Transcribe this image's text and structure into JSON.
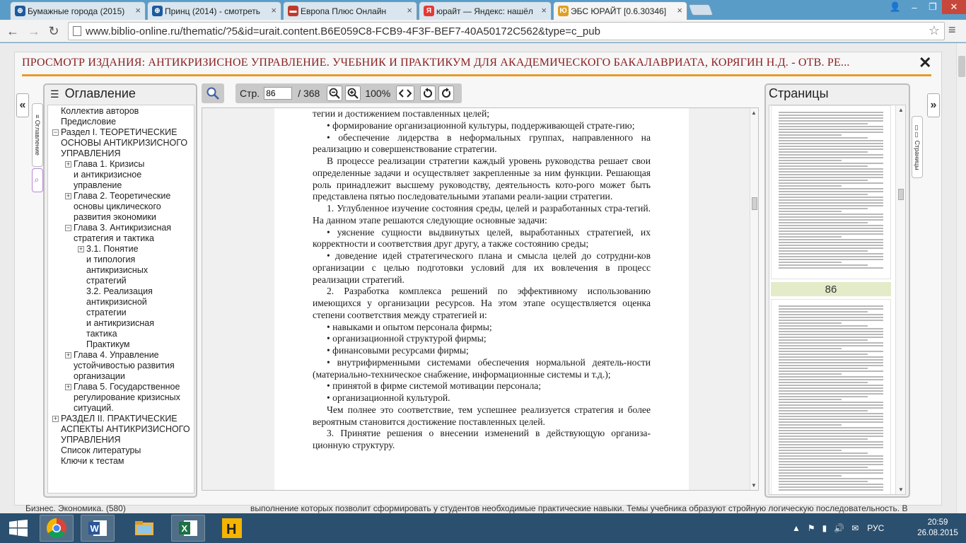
{
  "browser": {
    "tabs": [
      {
        "label": "Бумажные города (2015)",
        "icon": "film-icon",
        "color": "#1d5a9e",
        "active": false
      },
      {
        "label": "Принц (2014) - смотреть",
        "icon": "film-icon",
        "color": "#1d5a9e",
        "active": false
      },
      {
        "label": "Европа Плюс Онлайн",
        "icon": "radio-icon",
        "color": "#c0392b",
        "active": false
      },
      {
        "label": "юрайт — Яндекс: нашёл",
        "icon": "yandex-icon",
        "color": "#e53935",
        "active": false
      },
      {
        "label": "ЭБС ЮРАЙТ [0.6.30346]",
        "icon": "urait-icon",
        "color": "#e0a020",
        "active": true
      }
    ],
    "url": "www.biblio-online.ru/thematic/?5&id=urait.content.B6E059C8-FCB9-4F3F-BEF7-40A50172C562&type=c_pub",
    "back_glyph": "←",
    "forward_glyph": "→",
    "reload_glyph": "↻",
    "star_glyph": "☆",
    "menu_glyph": "≡",
    "close_glyph": "×",
    "win_controls": [
      "👤",
      "–",
      "❐",
      "✕"
    ]
  },
  "viewer": {
    "title": "ПРОСМОТР ИЗДАНИЯ: АНТИКРИЗИСНОЕ УПРАВЛЕНИЕ. УЧЕБНИК И ПРАКТИКУМ ДЛЯ АКАДЕМИЧЕСКОГО БАКАЛАВРИАТА, КОРЯГИН Н.Д. - ОТВ. РЕ...",
    "close_label": "✕",
    "left_toggle": "«",
    "right_toggle": "»",
    "left_vtab_label": "≡ Оглавление",
    "right_vtab_label": "▯▯ Страницы",
    "search_vtab_glyph": "⌕",
    "page_label": "Стр.",
    "page_value": "86",
    "page_total": "/ 368",
    "zoom": "100%",
    "accent": "#e89a2a",
    "title_color": "#8b2020"
  },
  "toc": {
    "header": "Оглавление",
    "items": [
      {
        "text": "Коллектив авторов",
        "level": 0,
        "toggle": ""
      },
      {
        "text": "Предисловие",
        "level": 0,
        "toggle": ""
      },
      {
        "text": "Раздел I. ТЕОРЕТИЧЕСКИЕ\nОСНОВЫ АНТИКРИЗИСНОГО\nУПРАВЛЕНИЯ",
        "level": 0,
        "toggle": "−"
      },
      {
        "text": "Глава 1. Кризисы\nи антикризисное\nуправление",
        "level": 1,
        "toggle": "+"
      },
      {
        "text": "Глава 2. Теоретические\nосновы циклического\nразвития экономики",
        "level": 1,
        "toggle": "+"
      },
      {
        "text": "Глава 3. Антикризисная\nстратегия и тактика",
        "level": 1,
        "toggle": "−"
      },
      {
        "text": "3.1. Понятие\nи типология\nантикризисных\nстратегий",
        "level": 2,
        "toggle": "+"
      },
      {
        "text": "3.2. Реализация\nантикризисной\nстратегии\nи антикризисная\nтактика",
        "level": 2,
        "toggle": ""
      },
      {
        "text": "Практикум",
        "level": 2,
        "toggle": ""
      },
      {
        "text": "Глава 4. Управление\nустойчивостью развития\nорганизации",
        "level": 1,
        "toggle": "+"
      },
      {
        "text": "Глава 5. Государственное\nрегулирование кризисных\nситуаций.",
        "level": 1,
        "toggle": "+"
      },
      {
        "text": "РАЗДЕЛ II. ПРАКТИЧЕСКИЕ\nАСПЕКТЫ АНТИКРИЗИСНОГО\nУПРАВЛЕНИЯ",
        "level": 0,
        "toggle": "+"
      },
      {
        "text": "Список литературы",
        "level": 0,
        "toggle": ""
      },
      {
        "text": "Ключи к тестам",
        "level": 0,
        "toggle": ""
      }
    ]
  },
  "document": {
    "paragraphs": [
      {
        "kind": "cont",
        "text": "тегии и достижением поставленных целей;"
      },
      {
        "kind": "bul",
        "text": "•  формирование организационной культуры, поддерживающей страте-гию;"
      },
      {
        "kind": "bul",
        "text": "•  обеспечение лидерства в неформальных группах, направленного на реализацию и совершенствование стратегии."
      },
      {
        "kind": "ind",
        "text": "В процессе реализации стратегии каждый уровень руководства решает свои определенные задачи и осуществляет закрепленные за ним функции. Решающая роль принадлежит высшему руководству, деятельность кото-рого может быть представлена пятью последовательными этапами реали-зации стратегии."
      },
      {
        "kind": "ind",
        "text": "1. Углубленное изучение состояния среды, целей и разработанных стра-тегий. На данном этапе решаются следующие основные задачи:"
      },
      {
        "kind": "bul",
        "text": "•  уяснение сущности выдвинутых целей, выработанных стратегией, их корректности и соответствия друг другу, а также состоянию среды;"
      },
      {
        "kind": "bul",
        "text": "•  доведение идей стратегического плана и смысла целей до сотрудни-ков организации с целью подготовки условий для их вовлечения в процесс реализации стратегий."
      },
      {
        "kind": "ind",
        "text": "2. Разработка комплекса решений по эффективному использованию имеющихся у организации ресурсов. На этом этапе осуществляется оценка степени соответствия между стратегией и:"
      },
      {
        "kind": "bul",
        "text": "•  навыками и опытом персонала фирмы;"
      },
      {
        "kind": "bul",
        "text": "•  организационной структурой фирмы;"
      },
      {
        "kind": "bul",
        "text": "•  финансовыми ресурсами фирмы;"
      },
      {
        "kind": "bul",
        "text": "•  внутрифирменными системами обеспечения нормальной деятель-ности (материально-техническое снабжение, информационные системы и т.д.);"
      },
      {
        "kind": "bul",
        "text": "•  принятой в фирме системой мотивации персонала;"
      },
      {
        "kind": "bul",
        "text": "•  организационной культурой."
      },
      {
        "kind": "ind",
        "text": "Чем полнее это соответствие, тем успешнее реализуется стратегия и более вероятным становится достижение поставленных целей."
      },
      {
        "kind": "ind",
        "text": "3. Принятие решения о внесении изменений в действующую организа-ционную структуру."
      }
    ]
  },
  "pages_panel": {
    "header": "Страницы",
    "current_page_number": "86"
  },
  "background_strip": {
    "left": "Бизнес. Экономика. (580)",
    "right": "выполнение которых позволит сформировать у студентов необходимые практические навыки. Темы учебника образуют стройную логическую последовательность. В"
  },
  "taskbar": {
    "apps": [
      {
        "name": "chrome",
        "running": true
      },
      {
        "name": "word",
        "running": true
      },
      {
        "name": "explorer",
        "running": false
      },
      {
        "name": "excel",
        "running": true
      },
      {
        "name": "h-app",
        "running": false
      }
    ],
    "tray_glyphs": [
      "▲",
      "⚑",
      "▮",
      "🔊",
      "✉"
    ],
    "language": "РУС",
    "time": "20:59",
    "date": "26.08.2015"
  }
}
